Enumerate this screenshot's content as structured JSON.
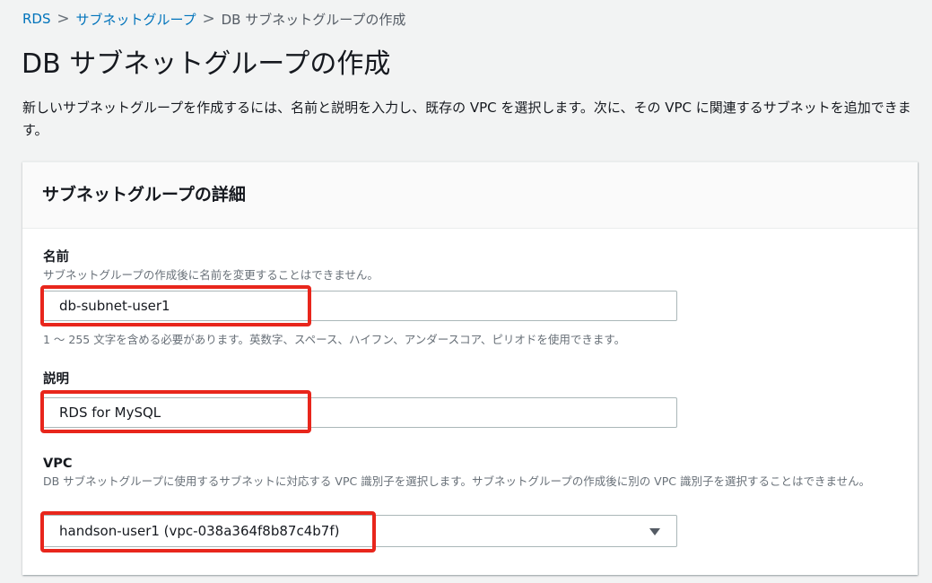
{
  "breadcrumb": {
    "items": [
      "RDS",
      "サブネットグループ",
      "DB サブネットグループの作成"
    ],
    "separator": ">"
  },
  "page": {
    "title": "DB サブネットグループの作成",
    "description": "新しいサブネットグループを作成するには、名前と説明を入力し、既存の VPC を選択します。次に、その VPC に関連するサブネットを追加できます。"
  },
  "panel": {
    "title": "サブネットグループの詳細"
  },
  "name_field": {
    "label": "名前",
    "hint": "サブネットグループの作成後に名前を変更することはできません。",
    "value": "db-subnet-user1",
    "constraint": "1 ～ 255 文字を含める必要があります。英数字、スペース、ハイフン、アンダースコア、ピリオドを使用できます。"
  },
  "description_field": {
    "label": "説明",
    "value": "RDS for MySQL"
  },
  "vpc_field": {
    "label": "VPC",
    "hint": "DB サブネットグループに使用するサブネットに対応する VPC 識別子を選択します。サブネットグループの作成後に別の VPC 識別子を選択することはできません。",
    "selected": "handson-user1 (vpc-038a364f8b87c4b7f)",
    "icon": "caret-down-icon"
  },
  "colors": {
    "link": "#0073bb",
    "highlight": "#e8261c",
    "background": "#f2f3f3"
  }
}
